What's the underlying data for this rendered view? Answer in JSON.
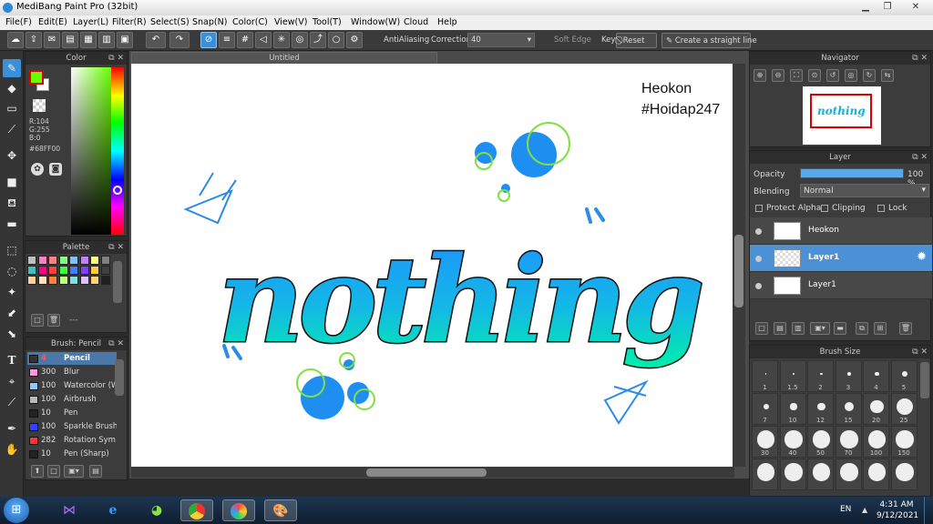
{
  "window": {
    "title": "MediBang Paint Pro (32bit)"
  },
  "menu": [
    "File(F)",
    "Edit(E)",
    "Layer(L)",
    "Filter(R)",
    "Select(S)",
    "Snap(N)",
    "Color(C)",
    "View(V)",
    "Tool(T)",
    "Window(W)",
    "Cloud",
    "Help"
  ],
  "toolbar": {
    "antialiasing": "AntiAliasing",
    "correction_label": "Correction",
    "correction_value": "40",
    "soft_edge": "Soft Edge",
    "key_label": "Key",
    "reset": "Reset",
    "straight_line": "Create a straight line"
  },
  "color_panel": {
    "title": "Color",
    "r": "R:104",
    "g": "G:255",
    "b": "B:0",
    "hex": "#68FF00",
    "fg_color": "#68FF00"
  },
  "palette_panel": {
    "title": "Palette",
    "hint": "---",
    "swatches": [
      "#c0c0c0",
      "#ff80c0",
      "#ff8080",
      "#80ff80",
      "#80c0ff",
      "#c080ff",
      "#ffff80",
      "#808080",
      "#40c0c0",
      "#ff0080",
      "#ff4040",
      "#40ff40",
      "#4080ff",
      "#8040ff",
      "#ffcc40",
      "#404040",
      "#ffd0a0",
      "#ffe0c0",
      "#ff8040",
      "#c0ff80",
      "#80e0e0",
      "#e0c0ff",
      "#ffd080",
      "#202020"
    ]
  },
  "brush_panel": {
    "title": "Brush: Pencil",
    "items": [
      {
        "size": "4",
        "name": "Pencil",
        "color": "#333333"
      },
      {
        "size": "300",
        "name": "Blur",
        "color": "#ff99dd"
      },
      {
        "size": "100",
        "name": "Watercolor (W",
        "color": "#88ccff"
      },
      {
        "size": "100",
        "name": "Airbrush",
        "color": "#bbbbbb"
      },
      {
        "size": "10",
        "name": "Pen",
        "color": "#222222"
      },
      {
        "size": "100",
        "name": "Sparkle Brush",
        "color": "#3344ff"
      },
      {
        "size": "282",
        "name": "Rotation Sym",
        "color": "#ff3333"
      },
      {
        "size": "10",
        "name": "Pen (Sharp)",
        "color": "#222222"
      }
    ]
  },
  "canvas": {
    "tab": "Untitled",
    "watermark_line1": "Heokon",
    "watermark_line2": "#Hoidap247",
    "artwork_word": "nothing"
  },
  "navigator": {
    "title": "Navigator"
  },
  "layer_panel": {
    "title": "Layer",
    "opacity_label": "Opacity",
    "opacity_value": "100 %",
    "opacity_fraction": 1.0,
    "blending_label": "Blending",
    "blending_value": "Normal",
    "protect_alpha": "Protect Alpha",
    "clipping": "Clipping",
    "lock": "Lock",
    "layers": [
      {
        "name": "Heokon",
        "selected": false
      },
      {
        "name": "Layer1",
        "selected": true
      },
      {
        "name": "Layer1",
        "selected": false
      }
    ]
  },
  "brush_size_panel": {
    "title": "Brush Size",
    "sizes": [
      "1",
      "1.5",
      "2",
      "3",
      "4",
      "5",
      "7",
      "10",
      "12",
      "15",
      "20",
      "25",
      "30",
      "40",
      "50",
      "70",
      "100",
      "150",
      "",
      "",
      "",
      "",
      "",
      ""
    ]
  },
  "taskbar": {
    "lang": "EN",
    "time": "4:31 AM",
    "date": "9/12/2021"
  }
}
